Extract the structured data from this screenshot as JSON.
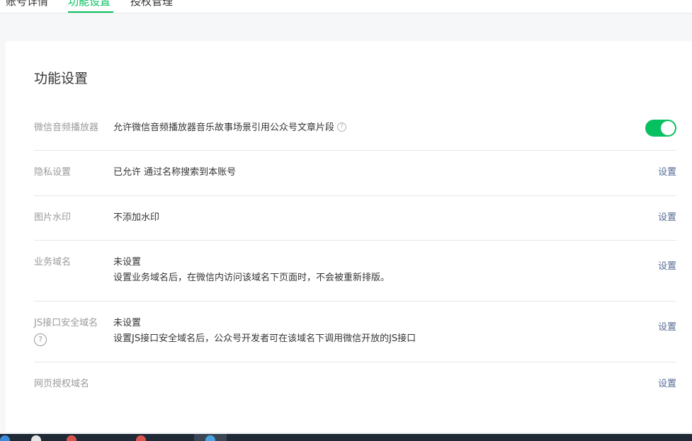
{
  "tabs": [
    {
      "label": "账号详情"
    },
    {
      "label": "功能设置",
      "active": true
    },
    {
      "label": "授权管理"
    }
  ],
  "section_title": "功能设置",
  "accent_color": "#07c160",
  "link_color": "#576b95",
  "rows": {
    "audio_player": {
      "label": "微信音频播放器",
      "value": "允许微信音频播放器音乐故事场景引用公众号文章片段",
      "help_icon": "question-circle",
      "toggle_on": true
    },
    "privacy": {
      "label": "隐私设置",
      "value": "已允许 通过名称搜索到本账号",
      "action": "设置"
    },
    "watermark": {
      "label": "图片水印",
      "value": "不添加水印",
      "action": "设置"
    },
    "business_domain": {
      "label": "业务域名",
      "value": "未设置",
      "desc": "设置业务域名后，在微信内访问该域名下页面时，不会被重新排版。",
      "action": "设置"
    },
    "js_domain": {
      "label": "JS接口安全域名",
      "help_icon": "question-circle",
      "value": "未设置",
      "desc": "设置JS接口安全域名后，公众号开发者可在该域名下调用微信开放的JS接口",
      "action": "设置"
    },
    "web_auth_domain": {
      "label": "网页授权域名",
      "action": "设置"
    }
  }
}
